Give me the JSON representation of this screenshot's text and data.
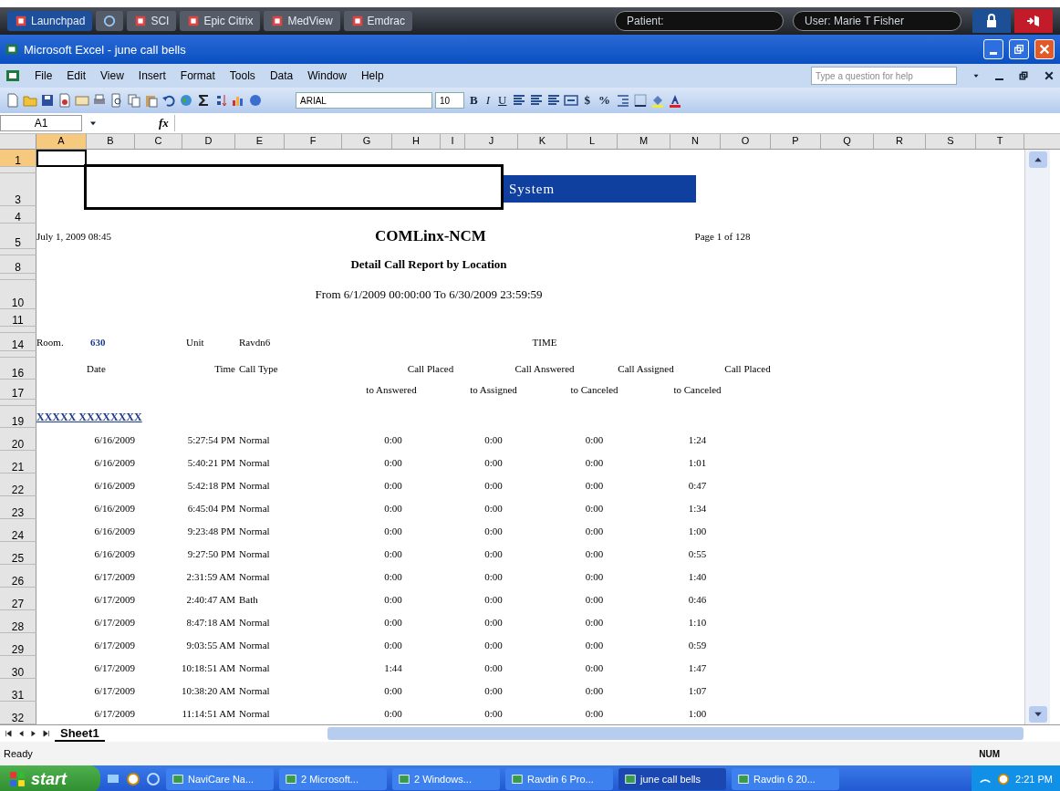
{
  "launcher": {
    "items": [
      {
        "kind": "tab",
        "label": "Launchpad",
        "selected": true
      },
      {
        "kind": "icon",
        "selected": false
      },
      {
        "kind": "tab",
        "label": "SCI",
        "selected": false
      },
      {
        "kind": "tab",
        "label": "Epic Citrix",
        "selected": false
      },
      {
        "kind": "tab",
        "label": "MedView",
        "selected": false
      },
      {
        "kind": "tab",
        "label": "Emdrac",
        "selected": false
      }
    ],
    "patient": "Patient:",
    "user": "User: Marie T Fisher"
  },
  "window": {
    "title": "Microsoft Excel - june call bells"
  },
  "menu": {
    "items": [
      "File",
      "Edit",
      "View",
      "Insert",
      "Format",
      "Tools",
      "Data",
      "Window",
      "Help"
    ],
    "help_placeholder": "Type a question for help"
  },
  "toolbar": {
    "font": "ARIAL",
    "size": "10",
    "bold": "B",
    "italic": "I",
    "underline": "U",
    "currency": "$",
    "percent": "%"
  },
  "formula_bar": {
    "name_box": "A1",
    "fx": "fx"
  },
  "sheet": {
    "columns": [
      {
        "label": "A",
        "selected": true
      },
      {
        "label": "B",
        "selected": false
      },
      {
        "label": "C",
        "selected": false
      },
      {
        "label": "D",
        "selected": false
      },
      {
        "label": "E",
        "selected": false
      },
      {
        "label": "F",
        "selected": false
      },
      {
        "label": "G",
        "selected": false
      },
      {
        "label": "H",
        "selected": false
      },
      {
        "label": "I",
        "selected": false
      },
      {
        "label": "J",
        "selected": false
      },
      {
        "label": "K",
        "selected": false
      },
      {
        "label": "L",
        "selected": false
      },
      {
        "label": "M",
        "selected": false
      },
      {
        "label": "N",
        "selected": false
      },
      {
        "label": "O",
        "selected": false
      },
      {
        "label": "P",
        "selected": false
      },
      {
        "label": "Q",
        "selected": false
      },
      {
        "label": "R",
        "selected": false
      },
      {
        "label": "S",
        "selected": false
      },
      {
        "label": "T",
        "selected": false
      }
    ],
    "rows": [
      {
        "kind": "blank",
        "number": "1",
        "selected": true
      },
      {
        "kind": "thin",
        "selected": false
      },
      {
        "kind": "banner",
        "number": "3",
        "selected": false,
        "banner": "System"
      },
      {
        "kind": "blank",
        "number": "4",
        "selected": false
      },
      {
        "kind": "heading",
        "number": "5",
        "selected": false,
        "date_stamp": "July 1, 2009 08:45",
        "title": "COMLinx-NCM",
        "page": "Page 1 of 128"
      },
      {
        "kind": "thin",
        "selected": false
      },
      {
        "kind": "subtitle",
        "number": "8",
        "selected": false,
        "subtitle": "Detail Call Report by Location"
      },
      {
        "kind": "thin",
        "selected": false
      },
      {
        "kind": "range",
        "number": "10",
        "selected": false,
        "range": "From 6/1/2009 00:00:00 To 6/30/2009 23:59:59"
      },
      {
        "kind": "blank",
        "number": "11",
        "selected": false
      },
      {
        "kind": "thin",
        "selected": false
      },
      {
        "kind": "room",
        "number": "14",
        "selected": false,
        "cells": [
          "Room.",
          "630",
          "Unit",
          "Ravdn6",
          "TIME"
        ]
      },
      {
        "kind": "thin",
        "selected": false
      },
      {
        "kind": "headings",
        "number": "16",
        "selected": false,
        "cells": [
          "Date",
          "Time",
          "Call Type",
          "Call Placed",
          "Call Answered",
          "Call Assigned",
          "Call Placed"
        ]
      },
      {
        "kind": "subheadings",
        "number": "17",
        "selected": false,
        "cells": [
          "to Answered",
          "to Assigned",
          "to Canceled",
          "to Canceled"
        ]
      },
      {
        "kind": "thin",
        "selected": false
      },
      {
        "kind": "group",
        "number": "19",
        "selected": false,
        "group_name": "XXXXX XXXXXXXX"
      },
      {
        "kind": "data",
        "number": "20",
        "selected": false,
        "cells": [
          "6/16/2009",
          "5:27:54 PM",
          "Normal",
          "0:00",
          "0:00",
          "0:00",
          "1:24"
        ]
      },
      {
        "kind": "data",
        "number": "21",
        "selected": false,
        "cells": [
          "6/16/2009",
          "5:40:21 PM",
          "Normal",
          "0:00",
          "0:00",
          "0:00",
          "1:01"
        ]
      },
      {
        "kind": "data",
        "number": "22",
        "selected": false,
        "cells": [
          "6/16/2009",
          "5:42:18 PM",
          "Normal",
          "0:00",
          "0:00",
          "0:00",
          "0:47"
        ]
      },
      {
        "kind": "data",
        "number": "23",
        "selected": false,
        "cells": [
          "6/16/2009",
          "6:45:04 PM",
          "Normal",
          "0:00",
          "0:00",
          "0:00",
          "1:34"
        ]
      },
      {
        "kind": "data",
        "number": "24",
        "selected": false,
        "cells": [
          "6/16/2009",
          "9:23:48 PM",
          "Normal",
          "0:00",
          "0:00",
          "0:00",
          "1:00"
        ]
      },
      {
        "kind": "data",
        "number": "25",
        "selected": false,
        "cells": [
          "6/16/2009",
          "9:27:50 PM",
          "Normal",
          "0:00",
          "0:00",
          "0:00",
          "0:55"
        ]
      },
      {
        "kind": "data",
        "number": "26",
        "selected": false,
        "cells": [
          "6/17/2009",
          "2:31:59 AM",
          "Normal",
          "0:00",
          "0:00",
          "0:00",
          "1:40"
        ]
      },
      {
        "kind": "data",
        "number": "27",
        "selected": false,
        "cells": [
          "6/17/2009",
          "2:40:47 AM",
          "Bath",
          "0:00",
          "0:00",
          "0:00",
          "0:46"
        ]
      },
      {
        "kind": "data",
        "number": "28",
        "selected": false,
        "cells": [
          "6/17/2009",
          "8:47:18 AM",
          "Normal",
          "0:00",
          "0:00",
          "0:00",
          "1:10"
        ]
      },
      {
        "kind": "data",
        "number": "29",
        "selected": false,
        "cells": [
          "6/17/2009",
          "9:03:55 AM",
          "Normal",
          "0:00",
          "0:00",
          "0:00",
          "0:59"
        ]
      },
      {
        "kind": "data",
        "number": "30",
        "selected": false,
        "cells": [
          "6/17/2009",
          "10:18:51 AM",
          "Normal",
          "1:44",
          "0:00",
          "0:00",
          "1:47"
        ]
      },
      {
        "kind": "data",
        "number": "31",
        "selected": false,
        "cells": [
          "6/17/2009",
          "10:38:20 AM",
          "Normal",
          "0:00",
          "0:00",
          "0:00",
          "1:07"
        ]
      },
      {
        "kind": "data",
        "number": "32",
        "selected": false,
        "cells": [
          "6/17/2009",
          "11:14:51 AM",
          "Normal",
          "0:00",
          "0:00",
          "0:00",
          "1:00"
        ]
      }
    ]
  },
  "sheet_tabs": [
    {
      "label": "Sheet1",
      "selected": true
    }
  ],
  "status_bar": {
    "status": "Ready",
    "num": "NUM"
  },
  "taskbar": {
    "start": "start",
    "tasks": [
      {
        "label": "NaviCare Na...",
        "selected": false
      },
      {
        "label": "2 Microsoft...",
        "selected": false
      },
      {
        "label": "2 Windows...",
        "selected": false
      },
      {
        "label": "Ravdin 6 Pro...",
        "selected": false
      },
      {
        "label": "june call bells",
        "selected": true
      },
      {
        "label": "Ravdin 6 20...",
        "selected": false
      }
    ],
    "clock": "2:21 PM"
  }
}
